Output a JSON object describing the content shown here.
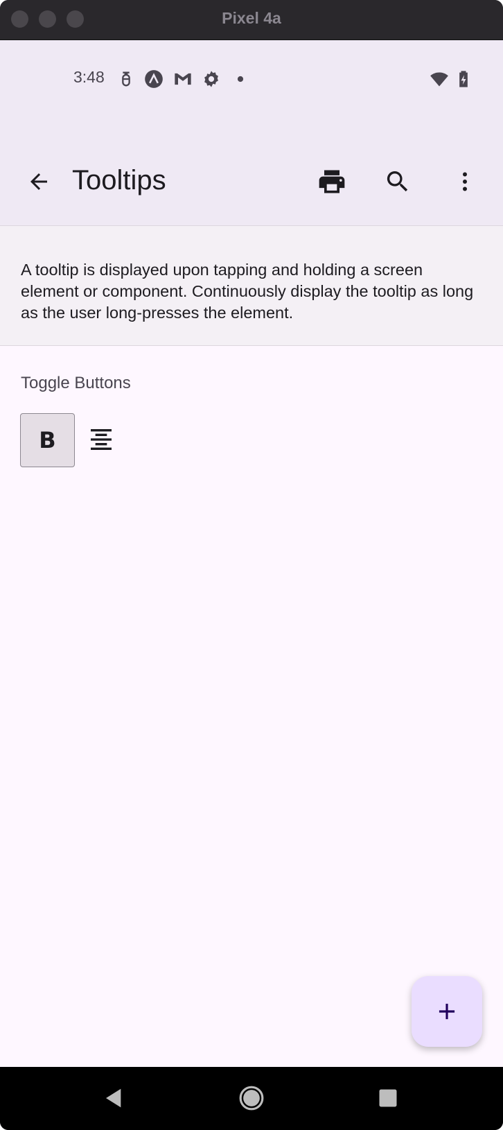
{
  "window": {
    "title": "Pixel 4a"
  },
  "status_bar": {
    "time": "3:48",
    "icons": [
      "usb-debug-icon",
      "android-studio-icon",
      "gmail-icon",
      "settings-gear-icon",
      "notification-dot-icon",
      "wifi-icon",
      "battery-charging-icon"
    ]
  },
  "app_bar": {
    "title": "Tooltips",
    "actions": [
      "back-arrow-icon",
      "print-icon",
      "search-icon",
      "more-vert-icon"
    ]
  },
  "description": {
    "text": "A tooltip is displayed upon tapping and holding a screen element or component. Continuously display the tooltip as long as the user long-presses the element."
  },
  "toggle_section": {
    "title": "Toggle Buttons",
    "bold_label": "B",
    "bold_selected": true,
    "center_icon": "format-align-center-icon"
  },
  "fab": {
    "icon": "add-icon"
  },
  "nav_bar": {
    "buttons": [
      "back-triangle-icon",
      "home-circle-icon",
      "recents-square-icon"
    ]
  },
  "colors": {
    "surface": "#fef7ff",
    "app_bar": "#efe9f4",
    "fab": "#eaddff",
    "on_surface": "#1d1b20",
    "toggle_selected": "#e5dee5"
  }
}
